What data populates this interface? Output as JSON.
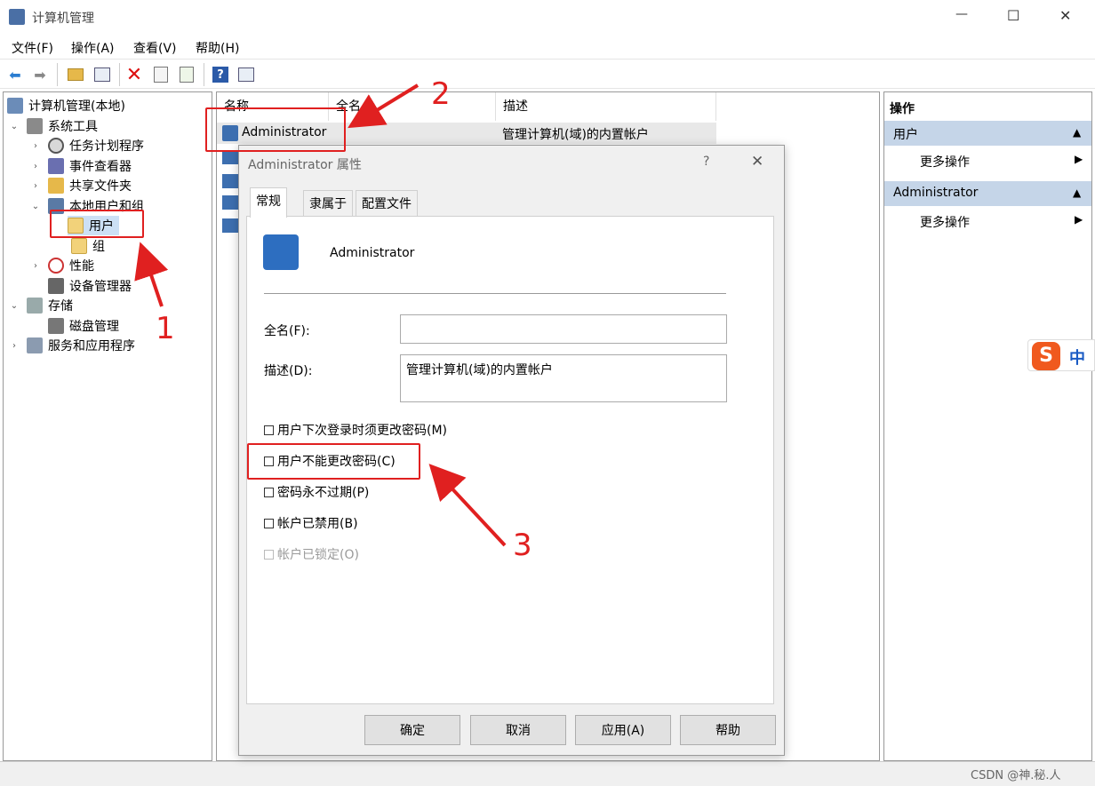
{
  "window": {
    "title": "计算机管理",
    "min": "—",
    "max": "☐",
    "close": "✕"
  },
  "menu": [
    "文件(F)",
    "操作(A)",
    "查看(V)",
    "帮助(H)"
  ],
  "tree": {
    "root": "计算机管理(本地)",
    "system_tools": "系统工具",
    "task_scheduler": "任务计划程序",
    "event_viewer": "事件查看器",
    "shared_folders": "共享文件夹",
    "local_users": "本地用户和组",
    "users": "用户",
    "groups": "组",
    "performance": "性能",
    "device_manager": "设备管理器",
    "storage": "存储",
    "disk_management": "磁盘管理",
    "services": "服务和应用程序"
  },
  "list": {
    "columns": [
      "名称",
      "全名",
      "描述"
    ],
    "row1": {
      "name": "Administrator",
      "fullname": "",
      "desc": "管理计算机(域)的内置帐户"
    }
  },
  "actions": {
    "header": "操作",
    "section1": "用户",
    "more1": "更多操作",
    "section2": "Administrator",
    "more2": "更多操作"
  },
  "dialog": {
    "title": "Administrator 属性",
    "help": "?",
    "close": "✕",
    "tabs": [
      "常规",
      "隶属于",
      "配置文件"
    ],
    "user_name": "Administrator",
    "fullname_label": "全名(F):",
    "fullname_value": "",
    "desc_label": "描述(D):",
    "desc_value": "管理计算机(域)的内置帐户",
    "checks": {
      "must_change": "用户下次登录时须更改密码(M)",
      "cannot_change": "用户不能更改密码(C)",
      "never_expires": "密码永不过期(P)",
      "disabled": "帐户已禁用(B)",
      "locked": "帐户已锁定(O)"
    },
    "buttons": {
      "ok": "确定",
      "cancel": "取消",
      "apply": "应用(A)",
      "help": "帮助"
    }
  },
  "annotations": {
    "one": "1",
    "two": "2",
    "three": "3"
  },
  "ime": {
    "label": "中",
    "logo": "S"
  },
  "watermark": "CSDN @神.秘.人",
  "colors": {
    "accent_red": "#e02020",
    "section_header": "#c5d5e8",
    "selection": "#cce0f5"
  }
}
